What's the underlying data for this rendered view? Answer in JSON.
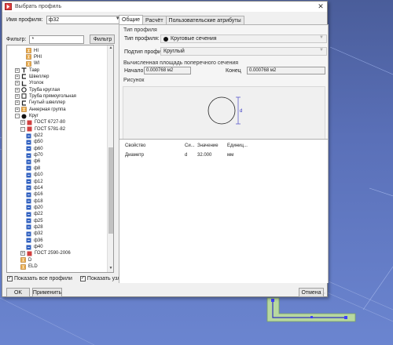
{
  "window": {
    "title": "Выбрать профиль",
    "close_glyph": "✕"
  },
  "profile_name": {
    "label": "Имя профиля:",
    "value": "ф32"
  },
  "filter": {
    "label": "Фильтр:",
    "value": "*",
    "button": "Фильтр"
  },
  "tree": [
    {
      "label": "HI",
      "icon": "i-beam-icon",
      "color": "#e8a030",
      "indent": 3,
      "expander": ""
    },
    {
      "label": "PHI",
      "icon": "i-beam-icon",
      "color": "#e8a030",
      "indent": 3,
      "expander": ""
    },
    {
      "label": "WI",
      "icon": "i-beam-icon",
      "color": "#e8a030",
      "indent": 3,
      "expander": ""
    },
    {
      "label": "Тавр",
      "icon": "tee-icon",
      "color": "#222222",
      "indent": 1,
      "expander": "+"
    },
    {
      "label": "Швеллер",
      "icon": "channel-icon",
      "color": "#222222",
      "indent": 1,
      "expander": "+"
    },
    {
      "label": "Уголок",
      "icon": "angle-icon",
      "color": "#222222",
      "indent": 1,
      "expander": "+"
    },
    {
      "label": "Труба круглая",
      "icon": "round-tube-icon",
      "color": "#222222",
      "indent": 1,
      "expander": "+"
    },
    {
      "label": "Труба прямоугольная",
      "icon": "rect-tube-icon",
      "color": "#222222",
      "indent": 1,
      "expander": "+"
    },
    {
      "label": "Гнутый швеллер",
      "icon": "bent-channel-icon",
      "color": "#222222",
      "indent": 1,
      "expander": "+"
    },
    {
      "label": "Анкерная группа",
      "icon": "anchor-group-icon",
      "color": "#e8a030",
      "indent": 1,
      "expander": "+"
    },
    {
      "label": "Круг",
      "icon": "circle-icon",
      "color": "#111111",
      "indent": 1,
      "expander": "-"
    },
    {
      "label": "ГОСТ 6727-80",
      "icon": "standard-icon",
      "color": "#d04040",
      "indent": 2,
      "expander": "+"
    },
    {
      "label": "ГОСТ 5781-82",
      "icon": "standard-icon",
      "color": "#d04040",
      "indent": 2,
      "expander": "-"
    },
    {
      "label": "ф22",
      "icon": "profile-icon",
      "color": "#3060c0",
      "indent": 3,
      "expander": ""
    },
    {
      "label": "ф50",
      "icon": "profile-icon",
      "color": "#3060c0",
      "indent": 3,
      "expander": ""
    },
    {
      "label": "ф60",
      "icon": "profile-icon",
      "color": "#3060c0",
      "indent": 3,
      "expander": ""
    },
    {
      "label": "ф70",
      "icon": "profile-icon",
      "color": "#3060c0",
      "indent": 3,
      "expander": ""
    },
    {
      "label": "ф6",
      "icon": "profile-icon",
      "color": "#3060c0",
      "indent": 3,
      "expander": ""
    },
    {
      "label": "ф8",
      "icon": "profile-icon",
      "color": "#3060c0",
      "indent": 3,
      "expander": ""
    },
    {
      "label": "ф10",
      "icon": "profile-icon",
      "color": "#3060c0",
      "indent": 3,
      "expander": ""
    },
    {
      "label": "ф12",
      "icon": "profile-icon",
      "color": "#3060c0",
      "indent": 3,
      "expander": ""
    },
    {
      "label": "ф14",
      "icon": "profile-icon",
      "color": "#3060c0",
      "indent": 3,
      "expander": ""
    },
    {
      "label": "ф16",
      "icon": "profile-icon",
      "color": "#3060c0",
      "indent": 3,
      "expander": ""
    },
    {
      "label": "ф18",
      "icon": "profile-icon",
      "color": "#3060c0",
      "indent": 3,
      "expander": ""
    },
    {
      "label": "ф20",
      "icon": "profile-icon",
      "color": "#3060c0",
      "indent": 3,
      "expander": ""
    },
    {
      "label": "ф22",
      "icon": "profile-icon",
      "color": "#3060c0",
      "indent": 3,
      "expander": ""
    },
    {
      "label": "ф25",
      "icon": "profile-icon",
      "color": "#3060c0",
      "indent": 3,
      "expander": ""
    },
    {
      "label": "ф28",
      "icon": "profile-icon",
      "color": "#3060c0",
      "indent": 3,
      "expander": ""
    },
    {
      "label": "ф32",
      "icon": "profile-icon",
      "color": "#3060c0",
      "indent": 3,
      "expander": ""
    },
    {
      "label": "ф36",
      "icon": "profile-icon",
      "color": "#3060c0",
      "indent": 3,
      "expander": ""
    },
    {
      "label": "ф40",
      "icon": "profile-icon",
      "color": "#3060c0",
      "indent": 3,
      "expander": ""
    },
    {
      "label": "ГОСТ 2590-2006",
      "icon": "standard-icon",
      "color": "#d04040",
      "indent": 2,
      "expander": "+"
    },
    {
      "label": "D",
      "icon": "i-beam-icon",
      "color": "#e8a030",
      "indent": 2,
      "expander": ""
    },
    {
      "label": "ELD",
      "icon": "i-beam-icon",
      "color": "#e8a030",
      "indent": 2,
      "expander": ""
    }
  ],
  "checkboxes": [
    {
      "label": "Показать все профили",
      "checked": true
    },
    {
      "label": "Показать узлы",
      "checked": true
    }
  ],
  "tabs": [
    {
      "label": "Общие",
      "active": true
    },
    {
      "label": "Расчёт",
      "active": false
    },
    {
      "label": "Пользовательские атрибуты",
      "active": false
    }
  ],
  "general": {
    "profile_type_section": "Тип профиля",
    "profile_type_label": "Тип профиля:",
    "profile_type_value": "Круговые сечения",
    "profile_subtype_label": "Подтип профиля:",
    "profile_subtype_value": "Круглый",
    "area_section": "Вычисленная площадь поперечного сечения",
    "start_label": "Начало",
    "start_value": "0.000768 м2",
    "end_label": "Конец",
    "end_value": "0.000768 м2",
    "picture_section": "Рисунок",
    "dimension_label": "d"
  },
  "properties": {
    "headers": [
      "Свойство",
      "Си...",
      "Значение",
      "Единиц..."
    ],
    "rows": [
      [
        "Диаметр",
        "d",
        "32.000",
        "мм"
      ]
    ]
  },
  "buttons": {
    "ok": "OK",
    "apply": "Применить",
    "cancel": "Отмена"
  }
}
